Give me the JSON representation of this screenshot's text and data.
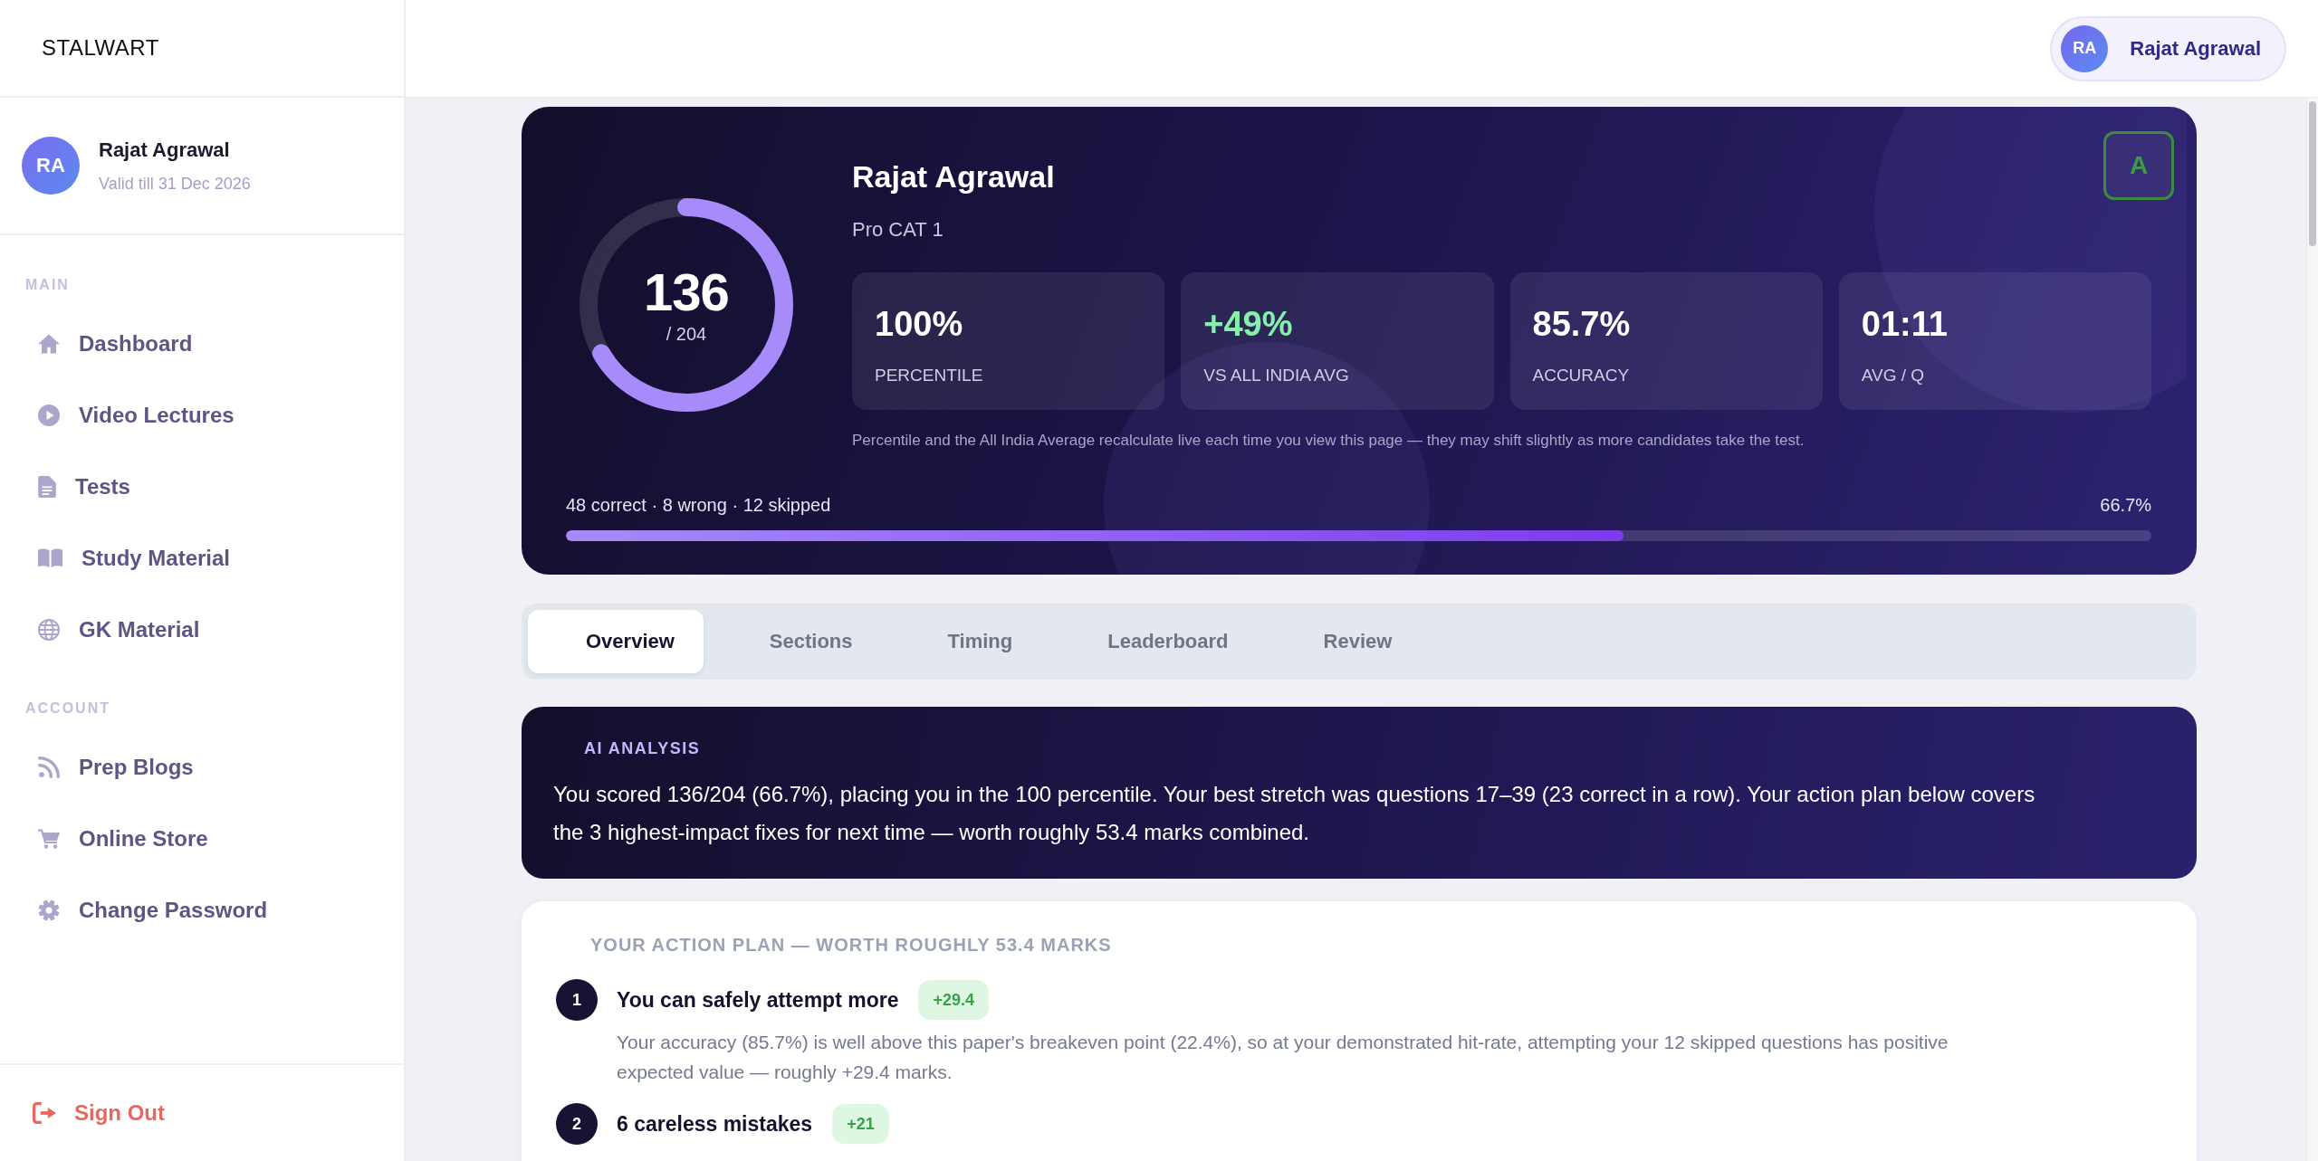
{
  "sidebar": {
    "brand": "STALWART",
    "profile": {
      "avatar": "RA",
      "name": "Rajat Agrawal",
      "validity": "Valid till 31 Dec 2026"
    },
    "sections": [
      {
        "heading": "MAIN",
        "items": [
          {
            "label": "Dashboard",
            "selected": false
          },
          {
            "label": "Video Lectures",
            "selected": false
          },
          {
            "label": "Tests",
            "selected": false
          },
          {
            "label": "Study Material",
            "selected": false
          },
          {
            "label": "GK Material",
            "selected": false
          }
        ]
      },
      {
        "heading": "ACCOUNT",
        "items": [
          {
            "label": "Prep Blogs",
            "selected": false
          },
          {
            "label": "Online Store",
            "selected": false
          },
          {
            "label": "Change Password",
            "selected": false
          }
        ]
      }
    ],
    "sign_out": "Sign Out"
  },
  "header": {
    "user": {
      "avatar": "RA",
      "name": "Rajat Agrawal"
    }
  },
  "result_card": {
    "name": "Rajat Agrawal",
    "test": "Pro CAT 1",
    "grade": "A",
    "score": {
      "value": "136",
      "total": "/ 204",
      "level": 0.667
    },
    "stats": [
      {
        "value": "100%",
        "label": "PERCENTILE",
        "color": "#ffffff"
      },
      {
        "value": "+49%",
        "label": "VS ALL INDIA AVG",
        "color": "#86efac"
      },
      {
        "value": "85.7%",
        "label": "ACCURACY",
        "color": "#ffffff"
      },
      {
        "value": "01:11",
        "label": "AVG / Q",
        "color": "#ffffff"
      }
    ],
    "note": "Percentile and the All India Average recalculate live each time you view this page — they may shift slightly as more candidates take the test.",
    "breakdown": "48 correct · 8 wrong · 12 skipped",
    "percent": "66.7%",
    "level": 0.667
  },
  "tabs": [
    {
      "label": "Overview",
      "selected": true
    },
    {
      "label": "Sections",
      "selected": false
    },
    {
      "label": "Timing",
      "selected": false
    },
    {
      "label": "Leaderboard",
      "selected": false
    },
    {
      "label": "Review",
      "selected": false
    }
  ],
  "ai_analysis": {
    "heading": "AI ANALYSIS",
    "text": "You scored 136/204 (66.7%), placing you in the 100 percentile. Your best stretch was questions 17–39 (23 correct in a row). Your action plan below covers the 3 highest-impact fixes for next time — worth roughly 53.4 marks combined."
  },
  "action_plan": {
    "heading": "YOUR ACTION PLAN — WORTH ROUGHLY 53.4 MARKS",
    "items": [
      {
        "number": "1",
        "title": "You can safely attempt more",
        "gain": "+29.4",
        "text": "Your accuracy (85.7%) is well above this paper's breakeven point (22.4%), so at your demonstrated hit-rate, attempting your 12 skipped questions has positive expected value — roughly +29.4 marks."
      },
      {
        "number": "2",
        "title": "6 careless mistakes",
        "gain": "+21"
      }
    ]
  }
}
